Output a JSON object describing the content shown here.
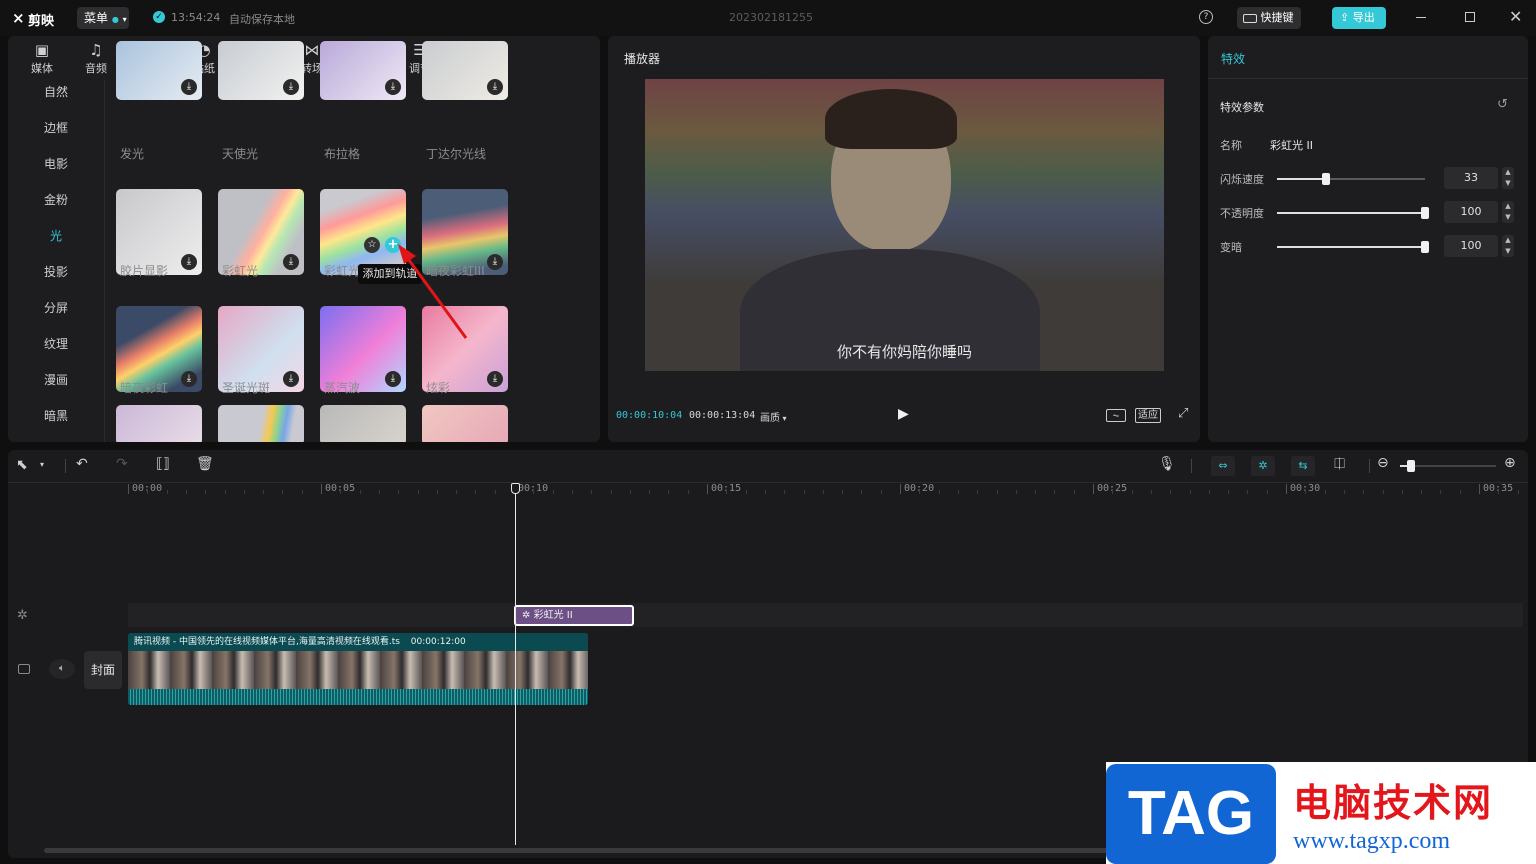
{
  "titlebar": {
    "app_name": "剪映",
    "menu_label": "菜单",
    "autosave_time": "13:54:24",
    "autosave_text": "自动保存本地",
    "project_name": "202302181255",
    "shortcut_label": "快捷键",
    "export_label": "导出"
  },
  "media_tabs": [
    {
      "label": "媒体",
      "icon": "media-icon"
    },
    {
      "label": "音频",
      "icon": "audio-icon"
    },
    {
      "label": "文本",
      "icon": "text-icon"
    },
    {
      "label": "贴纸",
      "icon": "sticker-icon"
    },
    {
      "label": "特效",
      "icon": "effects-icon",
      "active": true
    },
    {
      "label": "转场",
      "icon": "transition-icon"
    },
    {
      "label": "滤镜",
      "icon": "filter-icon"
    },
    {
      "label": "调节",
      "icon": "adjust-icon"
    }
  ],
  "categories": [
    "自然",
    "边框",
    "电影",
    "金粉",
    "光",
    "投影",
    "分屏",
    "纹理",
    "漫画",
    "暗黑"
  ],
  "active_category": "光",
  "effects": [
    {
      "name": "发光"
    },
    {
      "name": "天使光"
    },
    {
      "name": "布拉格"
    },
    {
      "name": "丁达尔光线"
    },
    {
      "name": "胶片显影"
    },
    {
      "name": "彩虹光"
    },
    {
      "name": "彩虹光"
    },
    {
      "name": "暗夜彩虹III"
    },
    {
      "name": "暗夜彩虹"
    },
    {
      "name": "圣诞光斑"
    },
    {
      "name": "蒸汽波"
    },
    {
      "name": "炫彩"
    }
  ],
  "tooltip": "添加到轨道",
  "player": {
    "title": "播放器",
    "subtitle": "你不有你妈陪你睡吗",
    "current_time": "00:00:10:04",
    "total_time": "00:00:13:04",
    "quality_label": "画质",
    "fit_label": "适应"
  },
  "props": {
    "tab_label": "特效",
    "section_title": "特效参数",
    "name_label": "名称",
    "name_value": "彩虹光 II",
    "params": [
      {
        "label": "闪烁速度",
        "value": 33,
        "max": 100
      },
      {
        "label": "不透明度",
        "value": 100,
        "max": 100
      },
      {
        "label": "变暗",
        "value": 100,
        "max": 100
      }
    ]
  },
  "timeline": {
    "ticks": [
      "00:00",
      "00:05",
      "00:10",
      "00:15",
      "00:20",
      "00:25",
      "00:30",
      "00:35"
    ],
    "effect_clip_label": "彩虹光 II",
    "video_clip_title": "腾讯视频 - 中国领先的在线视频媒体平台,海量高清视频在线观看.ts",
    "video_clip_duration": "00:00:12:00",
    "cover_label": "封面"
  },
  "watermark": {
    "logo_text": "TAG",
    "site_name": "电脑技术网",
    "site_url": "www.tagxp.com"
  },
  "colors": {
    "accent": "#35c8d6",
    "effect_clip": "#6b4f85",
    "video_clip": "#0e5d63",
    "watermark_blue": "#1266d4",
    "watermark_red": "#e3161b"
  }
}
